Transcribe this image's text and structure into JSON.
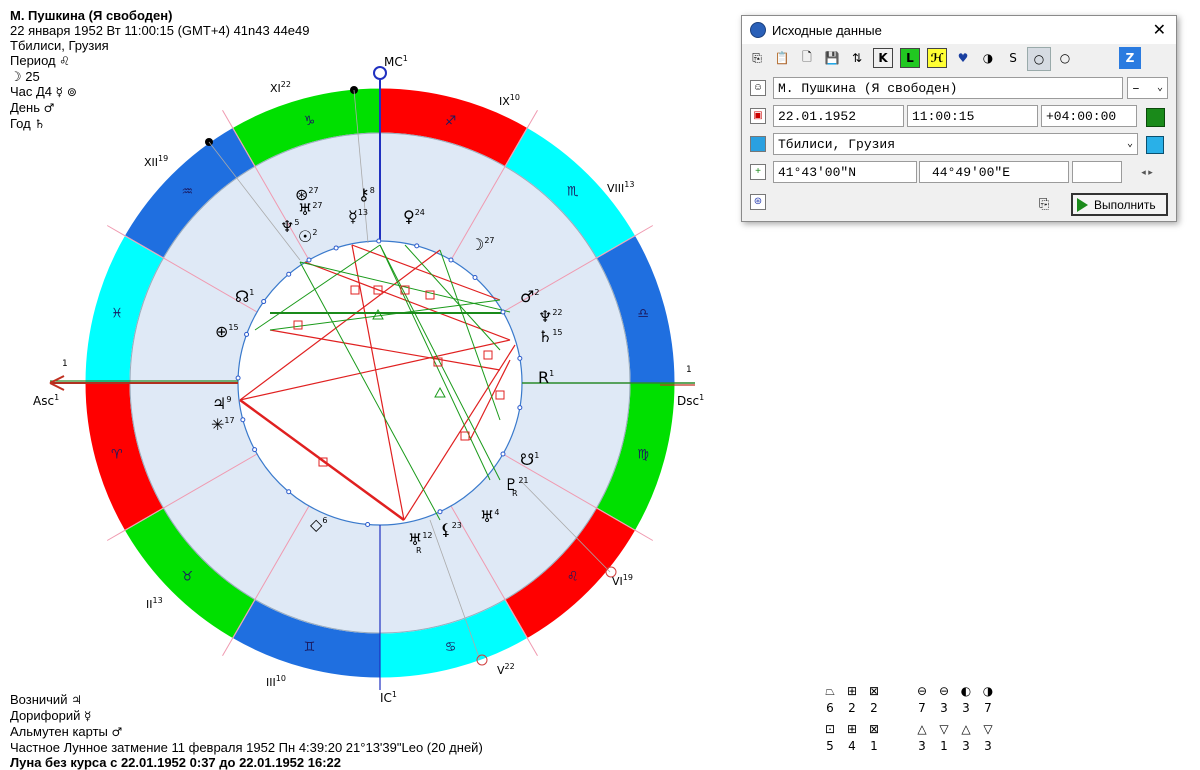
{
  "header": {
    "name": "М. Пушкина (Я свободен)",
    "datetime": "22 января 1952  Вт  11:00:15 (GMT+4) 41n43  44e49",
    "place": "Тбилиси, Грузия",
    "lines": [
      {
        "label": "Период",
        "glyph": "♌"
      },
      {
        "label": "☽  25",
        "glyph": ""
      },
      {
        "label": "Час Д4",
        "glyph": "☿ ⊚"
      },
      {
        "label": "День",
        "glyph": "♂"
      },
      {
        "label": "Год",
        "glyph": "♄"
      }
    ]
  },
  "chart": {
    "axes": {
      "mc": "MC",
      "mc_sup": "1",
      "ic": "IC",
      "ic_sup": "1",
      "asc": "Asc",
      "asc_sup": "1",
      "dsc": "Dsc",
      "dsc_sup": "1",
      "asc_top": "1",
      "dsc_top": "1"
    },
    "houses": [
      {
        "label": "XI",
        "sup": "22"
      },
      {
        "label": "IX",
        "sup": "10"
      },
      {
        "label": "XII",
        "sup": "19"
      },
      {
        "label": "VIII",
        "sup": "13"
      },
      {
        "label": "II",
        "sup": "13"
      },
      {
        "label": "VI",
        "sup": "19"
      },
      {
        "label": "III",
        "sup": "10"
      },
      {
        "label": "V",
        "sup": "22"
      }
    ],
    "signs": [
      "♑",
      "♐",
      "♏",
      "♎",
      "♍",
      "♌",
      "♋",
      "♊",
      "♉",
      "♈",
      "♓",
      "♒"
    ],
    "sign_colors": {
      "fire": "#ff0000",
      "earth": "#00e000",
      "air": "#00ffff",
      "water": "#1f6fe0"
    },
    "planets": [
      {
        "glyph": "⊛",
        "deg": "27"
      },
      {
        "glyph": "⚷",
        "deg": "8"
      },
      {
        "glyph": "♅",
        "deg": "27"
      },
      {
        "glyph": "♆",
        "deg": "5"
      },
      {
        "glyph": "☿",
        "deg": "13"
      },
      {
        "glyph": "♀",
        "deg": "24"
      },
      {
        "glyph": "☉",
        "deg": "2"
      },
      {
        "glyph": "☽",
        "deg": "27"
      },
      {
        "glyph": "☊",
        "deg": "1"
      },
      {
        "glyph": "♂",
        "deg": "2"
      },
      {
        "glyph": "♆",
        "deg": "22"
      },
      {
        "glyph": "♄",
        "deg": "15"
      },
      {
        "glyph": "⊕",
        "deg": "15"
      },
      {
        "glyph": "♃",
        "deg": "9"
      },
      {
        "glyph": "✳",
        "deg": "17"
      },
      {
        "glyph": "☋",
        "deg": "1"
      },
      {
        "glyph": "♇",
        "deg": "21"
      },
      {
        "glyph": "♅",
        "deg": "4"
      },
      {
        "glyph": "◇",
        "deg": "6"
      },
      {
        "glyph": "⚸",
        "deg": "23"
      },
      {
        "glyph": "♅",
        "deg": "12"
      },
      {
        "glyph": "R",
        "deg": "1"
      }
    ],
    "retro": "R"
  },
  "footer": {
    "lines": [
      {
        "label": "Возничий",
        "glyph": "♃"
      },
      {
        "label": "Дорифорий",
        "glyph": "☿"
      },
      {
        "label": "Альмутен карты",
        "glyph": "♂"
      }
    ],
    "eclipse": "Частное Лунное затмение 11 февраля 1952 Пн  4:39:20 21°13'39\"Leo (20 дней)",
    "void_moon": "Луна без курса с 22.01.1952  0:37 до 22.01.1952 16:22"
  },
  "legend": {
    "top_icons": [
      "⏢",
      "⊞",
      "⊠",
      "⊖",
      "⊖",
      "◐",
      "◑"
    ],
    "top_values": [
      "6",
      "2",
      "2",
      "7",
      "3",
      "3",
      "7"
    ],
    "bottom_icons": [
      "⊡",
      "⊞",
      "⊠",
      "△",
      "▽",
      "△",
      "▽"
    ],
    "bottom_values": [
      "5",
      "4",
      "1",
      "3",
      "1",
      "3",
      "3"
    ]
  },
  "dialog": {
    "title": "Исходные данные",
    "close": "✕",
    "toolbar": [
      "⎘",
      "📋",
      "🗋",
      "💾",
      "⇅",
      "K",
      "L",
      "ℋ",
      "♥",
      "◑",
      "S",
      "○",
      "○",
      "Z"
    ],
    "name_value": "М. Пушкина (Я свободен)",
    "gender_value": "–",
    "date_value": "22.01.1952",
    "time_value": "11:00:15",
    "tz_value": "+04:00:00",
    "place_value": "Тбилиси, Грузия",
    "lat_value": "41°43'00\"N",
    "lon_value": "44°49'00\"E",
    "run_label": "Выполнить"
  }
}
